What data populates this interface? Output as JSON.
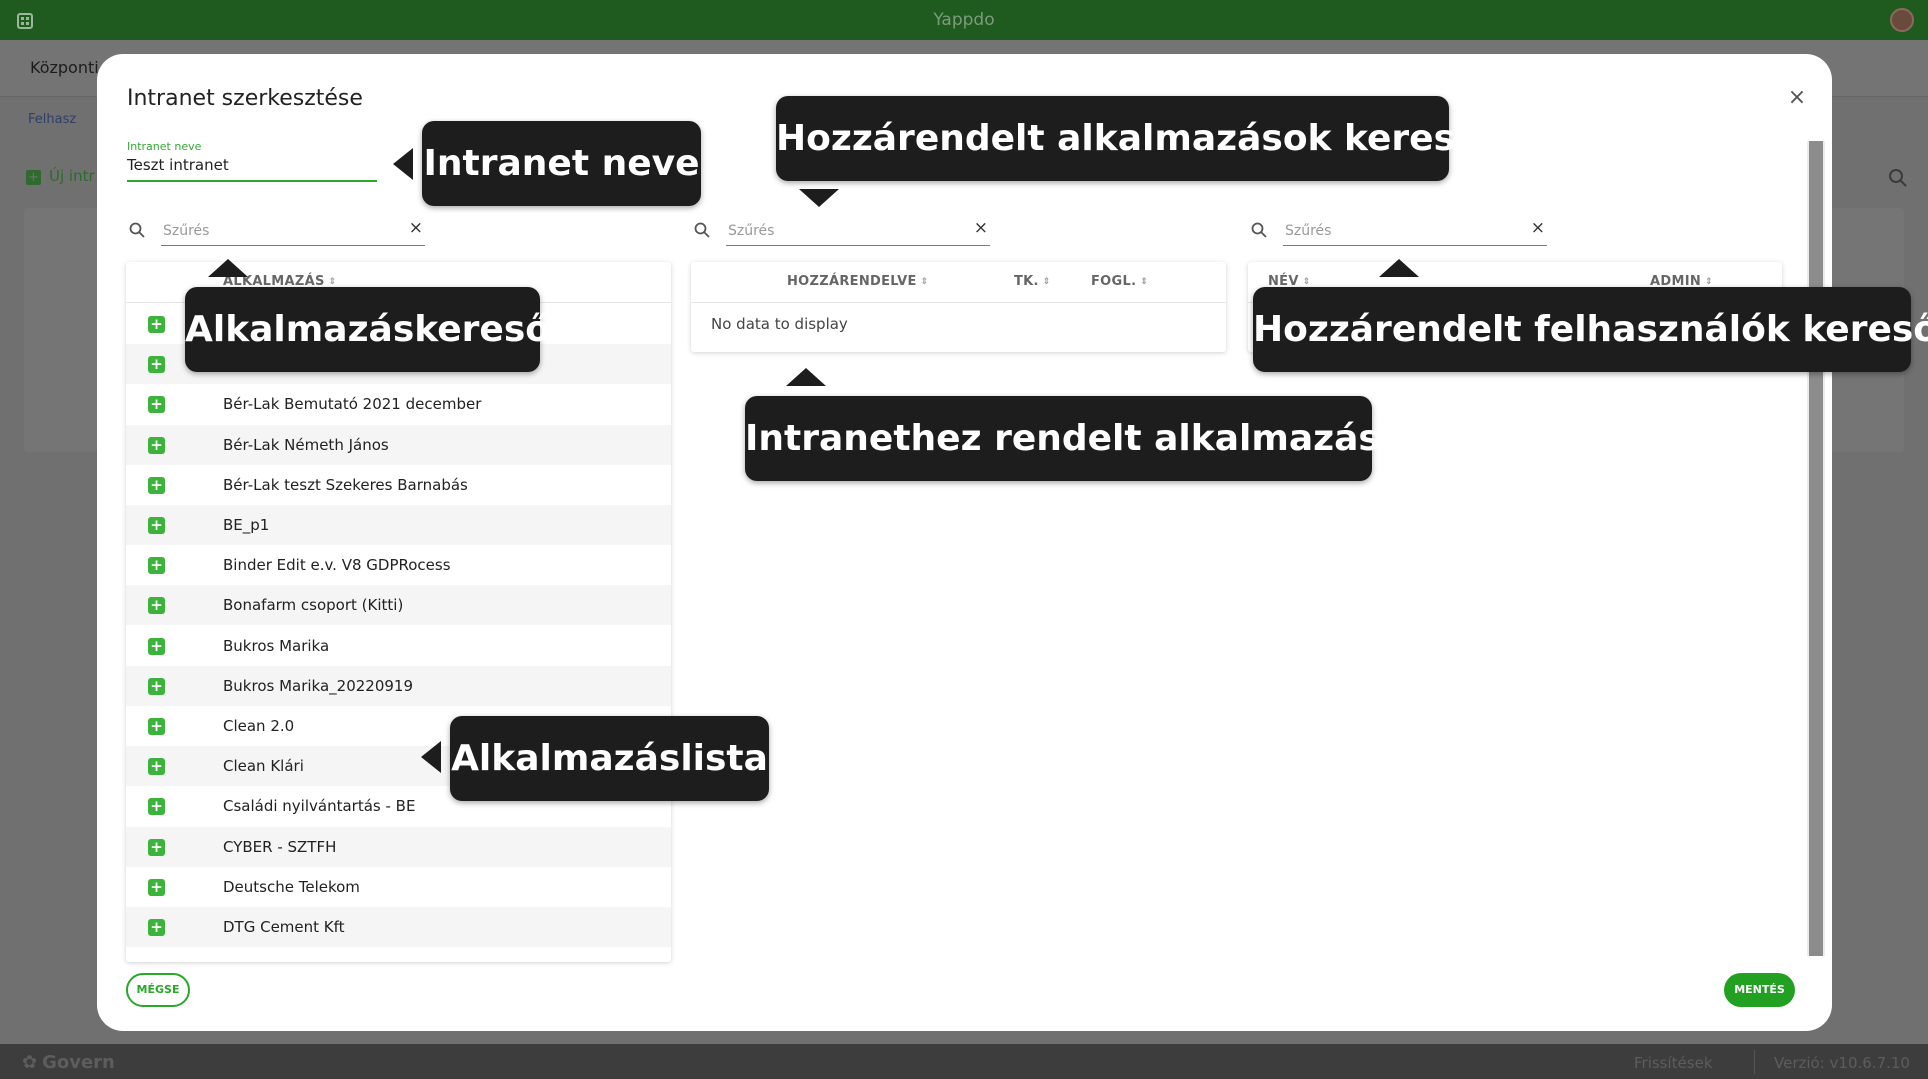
{
  "topbar": {
    "title": "Yappdo"
  },
  "background": {
    "header_title": "Központi",
    "tab_label": "Felhasz",
    "new_button": "Új intr"
  },
  "modal": {
    "title": "Intranet szerkesztése",
    "name_field": {
      "label": "Intranet neve",
      "value": "Teszt intranet"
    },
    "filter_placeholder": "Szűrés",
    "apps_panel": {
      "column": "ALKALMAZÁS",
      "rows": [
        "",
        "",
        "Bér-Lak Bemutató 2021 december",
        "Bér-Lak Németh János",
        "Bér-Lak teszt Szekeres Barnabás",
        "BE_p1",
        "Binder Edit e.v. V8 GDPRocess",
        "Bonafarm csoport (Kitti)",
        "Bukros Marika",
        "Bukros Marika_20220919",
        "Clean 2.0",
        "Clean Klári",
        "Családi nyilvántartás - BE",
        "CYBER - SZTFH",
        "Deutsche Telekom",
        "DTG Cement Kft"
      ]
    },
    "assigned_panel": {
      "columns": [
        "HOZZÁRENDELVE",
        "TK.",
        "FOGL."
      ],
      "empty_text": "No data to display"
    },
    "users_panel": {
      "columns": [
        "NÉV",
        "ADMIN"
      ]
    },
    "cancel_label": "MÉGSE",
    "save_label": "MENTÉS"
  },
  "callouts": {
    "intranet_name": "Intranet neve",
    "assigned_search": "Hozzárendelt alkalmazások keresője",
    "app_search": "Alkalmazáskereső",
    "user_search": "Hozzárendelt felhasználók keresője",
    "assigned_apps": "Intranethez rendelt alkalmazások",
    "app_list": "Alkalmazáslista"
  },
  "footer": {
    "brand": "Govern",
    "updates": "Frissítések",
    "version": "Verzió: v10.6.7.10"
  },
  "colors": {
    "accent": "#2aa82a",
    "topbar": "#1f5a1f",
    "callout": "#1d1d1d"
  }
}
